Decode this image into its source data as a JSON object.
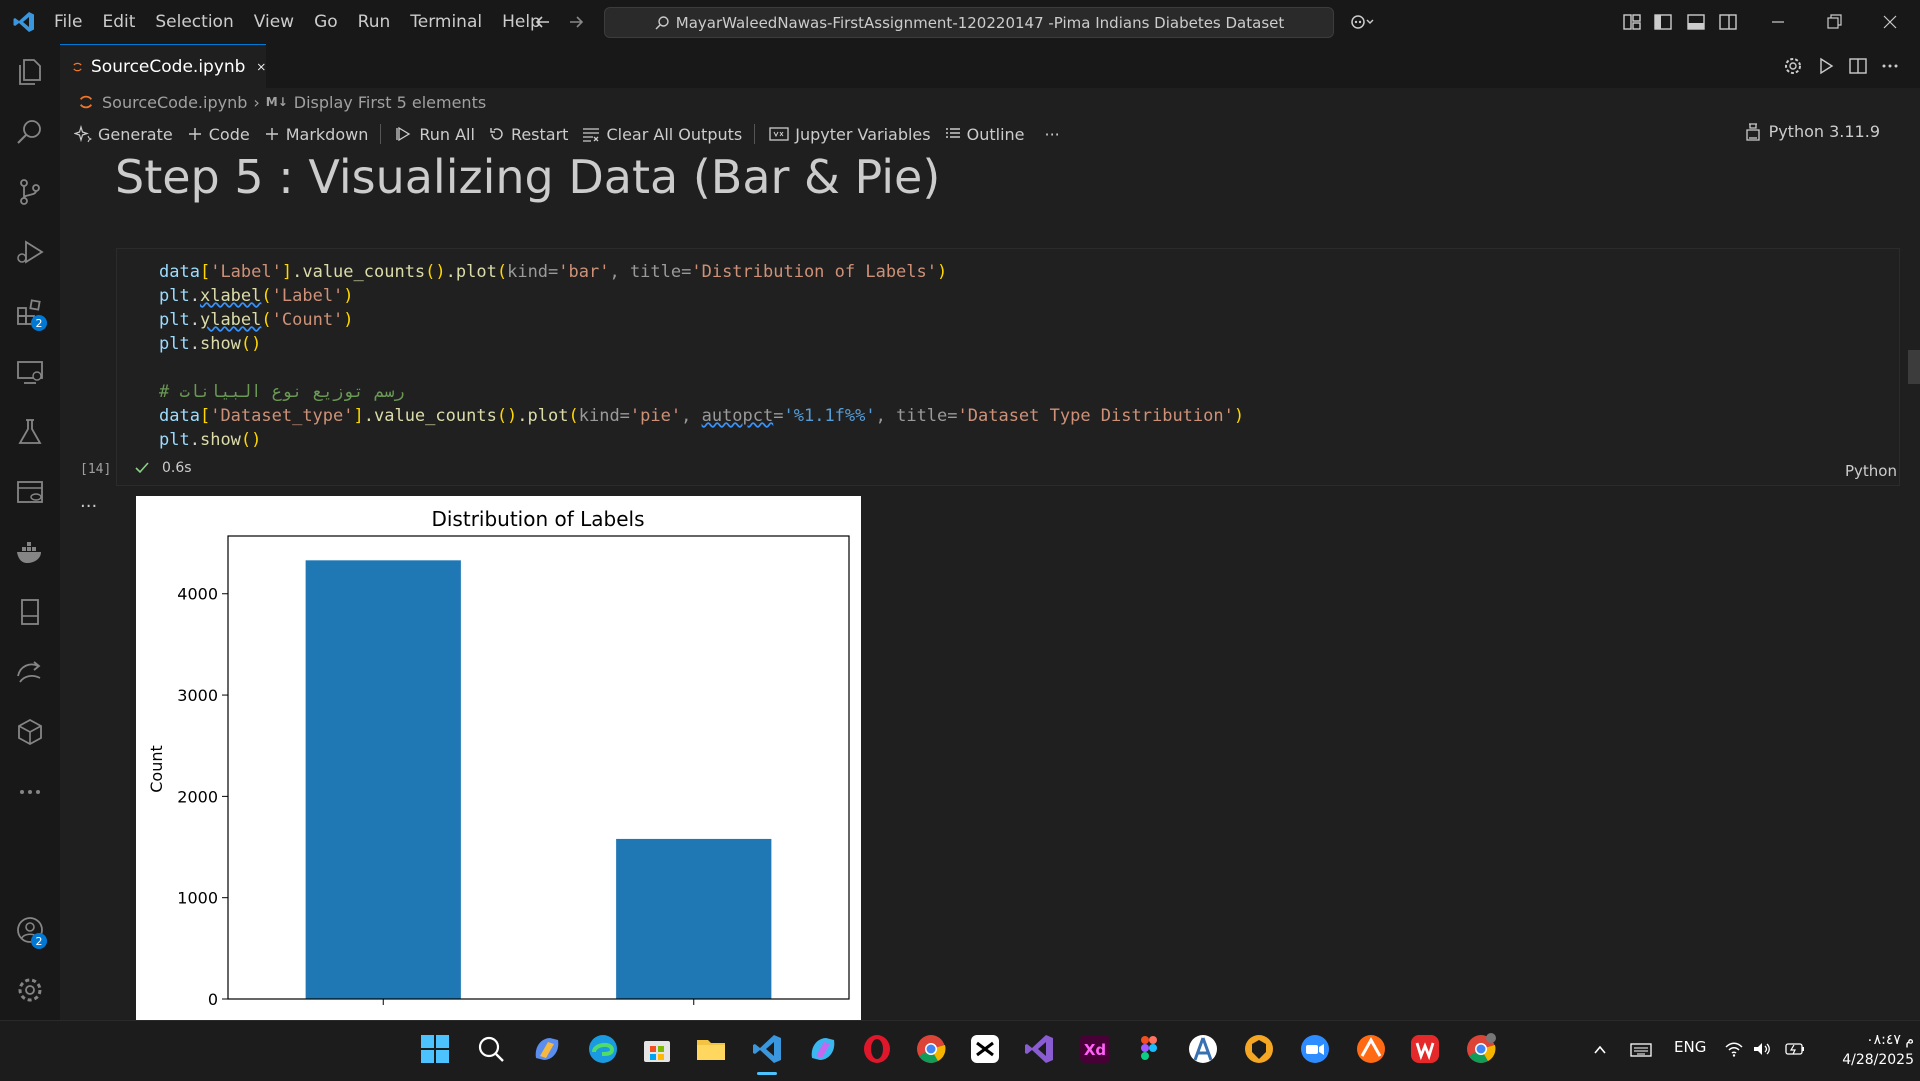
{
  "menu": [
    "File",
    "Edit",
    "Selection",
    "View",
    "Go",
    "Run",
    "Terminal",
    "Help"
  ],
  "search": {
    "text": "MayarWaleedNawas-FirstAssignment-120220147 -Pima Indians Diabetes Dataset"
  },
  "tab": {
    "label": "SourceCode.ipynb"
  },
  "breadcrumb": {
    "file": "SourceCode.ipynb",
    "md_marker": "M↓",
    "section": "Display First 5 elements"
  },
  "toolbar": {
    "generate": "Generate",
    "code": "Code",
    "markdown": "Markdown",
    "run_all": "Run All",
    "restart": "Restart",
    "clear_outputs": "Clear All Outputs",
    "variables": "Jupyter Variables",
    "outline": "Outline",
    "more": "···"
  },
  "kernel": {
    "label": "Python 3.11.9"
  },
  "heading": {
    "text": "Step 5 : Visualizing Data (Bar & Pie)"
  },
  "cell": {
    "exec_count": "[14]",
    "duration": "0.6s",
    "language": "Python",
    "lines": {
      "l1_a": "data",
      "l1_b": "[",
      "l1_c": "'Label'",
      "l1_d": "]",
      "l1_e": ".value_counts",
      "l1_f": "()",
      "l1_g": ".plot",
      "l1_h": "(",
      "l1_i": "kind=",
      "l1_j": "'bar'",
      "l1_k": ", title=",
      "l1_l": "'Distribution of Labels'",
      "l1_m": ")",
      "l2_a": "plt",
      "l2_b": ".",
      "l2_c": "xlabel",
      "l2_d": "(",
      "l2_e": "'Label'",
      "l2_f": ")",
      "l3_a": "plt",
      "l3_b": ".",
      "l3_c": "ylabel",
      "l3_d": "(",
      "l3_e": "'Count'",
      "l3_f": ")",
      "l4_a": "plt",
      "l4_b": ".",
      "l4_c": "show",
      "l4_d": "()",
      "l5": "# رسم توزيع نوع البيانات",
      "l6_a": "data",
      "l6_b": "[",
      "l6_c": "'Dataset_type'",
      "l6_d": "]",
      "l6_e": ".value_counts",
      "l6_f": "()",
      "l6_g": ".plot",
      "l6_h": "(",
      "l6_i": "kind=",
      "l6_j": "'pie'",
      "l6_k": ", ",
      "l6_l": "autopct",
      "l6_m": "=",
      "l6_n": "'%1.1f%%'",
      "l6_o": ", title=",
      "l6_p": "'Dataset Type Distribution'",
      "l6_q": ")",
      "l7_a": "plt",
      "l7_b": ".",
      "l7_c": "show",
      "l7_d": "()"
    }
  },
  "output": {
    "dots": "···"
  },
  "chart_data": {
    "type": "bar",
    "title": "Distribution of Labels",
    "xlabel": "",
    "ylabel": "Count",
    "categories": [
      "",
      ""
    ],
    "values": [
      4330,
      1580
    ],
    "ylim": [
      0,
      4570
    ],
    "yticks": [
      0,
      1000,
      2000,
      3000,
      4000
    ],
    "color": "#1f77b4",
    "grid": false
  },
  "activity_badges": {
    "extensions": "2",
    "accounts": "2"
  },
  "tray": {
    "lang": "ENG",
    "time": "م ٠٨:٤٧",
    "date": "4/28/2025"
  },
  "colors": {
    "accent": "#0078d4",
    "bar": "#1f77b4",
    "bg": "#1f1f1f"
  }
}
